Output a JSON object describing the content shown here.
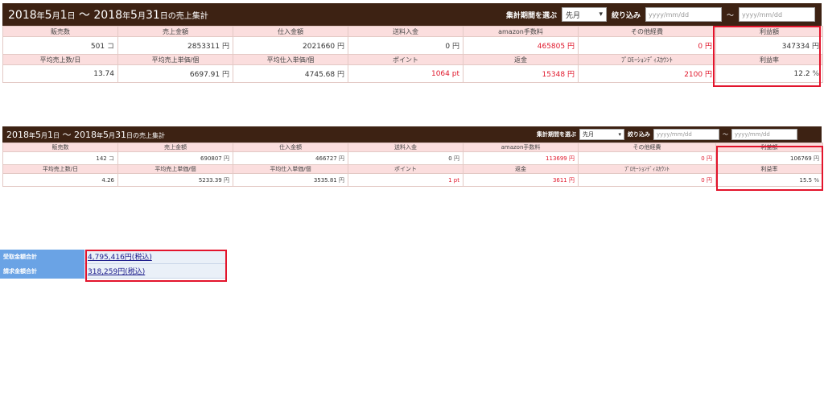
{
  "summary_panel_1": {
    "title": {
      "start_year": "2018",
      "start_month": "5",
      "start_day": "1",
      "end_year": "2018",
      "end_month": "5",
      "end_day": "31",
      "suffix": "の売上集計",
      "y": "年",
      "m": "月",
      "d": "日",
      "sep": " ～ "
    },
    "period_label": "集計期間を選ぶ",
    "period_select": "先月",
    "filter_label": "絞り込み",
    "date_from_placeholder": "yyyy/mm/dd",
    "date_to_placeholder": "yyyy/mm/dd",
    "tilde": "～",
    "row1_labels": [
      "販売数",
      "売上金額",
      "仕入金額",
      "送料入金",
      "amazon手数料",
      "その他経費",
      "利益額"
    ],
    "row1_values": [
      {
        "v": "501",
        "u": "コ"
      },
      {
        "v": "2853311",
        "u": "円"
      },
      {
        "v": "2021660",
        "u": "円"
      },
      {
        "v": "0",
        "u": "円"
      },
      {
        "v": "465805",
        "u": "円"
      },
      {
        "v": "0",
        "u": "円"
      },
      {
        "v": "347334",
        "u": "円"
      }
    ],
    "row2_labels": [
      "平均売上数/日",
      "平均売上単価/個",
      "平均仕入単価/個",
      "ポイント",
      "返金",
      "ﾌﾟﾛﾓｰｼｮﾝﾃﾞｨｽｶｳﾝﾄ",
      "利益率"
    ],
    "row2_values": [
      {
        "v": "13.74",
        "u": ""
      },
      {
        "v": "6697.91",
        "u": "円"
      },
      {
        "v": "4745.68",
        "u": "円"
      },
      {
        "v": "1064",
        "u": "pt"
      },
      {
        "v": "15348",
        "u": "円"
      },
      {
        "v": "2100",
        "u": "円"
      },
      {
        "v": "12.2",
        "u": "%"
      }
    ]
  },
  "summary_panel_2": {
    "title": {
      "start_year": "2018",
      "start_month": "5",
      "start_day": "1",
      "end_year": "2018",
      "end_month": "5",
      "end_day": "31",
      "suffix": "の売上集計",
      "y": "年",
      "m": "月",
      "d": "日",
      "sep": " ～ "
    },
    "period_label": "集計期間を選ぶ",
    "period_select": "先月",
    "filter_label": "絞り込み",
    "date_from_placeholder": "yyyy/mm/dd",
    "date_to_placeholder": "yyyy/mm/dd",
    "tilde": "～",
    "row1_labels": [
      "販売数",
      "売上金額",
      "仕入金額",
      "送料入金",
      "amazon手数料",
      "その他経費",
      "利益額"
    ],
    "row1_values": [
      {
        "v": "142",
        "u": "コ"
      },
      {
        "v": "690807",
        "u": "円"
      },
      {
        "v": "466727",
        "u": "円"
      },
      {
        "v": "0",
        "u": "円"
      },
      {
        "v": "113699",
        "u": "円"
      },
      {
        "v": "0",
        "u": "円"
      },
      {
        "v": "106769",
        "u": "円"
      }
    ],
    "row2_labels": [
      "平均売上数/日",
      "平均売上単価/個",
      "平均仕入単価/個",
      "ポイント",
      "返金",
      "ﾌﾟﾛﾓｰｼｮﾝﾃﾞｨｽｶｳﾝﾄ",
      "利益率"
    ],
    "row2_values": [
      {
        "v": "4.26",
        "u": ""
      },
      {
        "v": "5233.39",
        "u": "円"
      },
      {
        "v": "3535.81",
        "u": "円"
      },
      {
        "v": "1",
        "u": "pt"
      },
      {
        "v": "3611",
        "u": "円"
      },
      {
        "v": "0",
        "u": "円"
      },
      {
        "v": "15.5",
        "u": "%"
      }
    ]
  },
  "totals": {
    "received_label": "受取金額合計",
    "received_value": "4,795,416円(税込)",
    "billed_label": "請求金額合計",
    "billed_value": "318,259円(税込)"
  },
  "colors": {
    "header_bg": "#3d2213",
    "label_bg": "#fbdede",
    "highlight_red": "#e0182c",
    "totals_label_bg": "#6aa3e5"
  }
}
